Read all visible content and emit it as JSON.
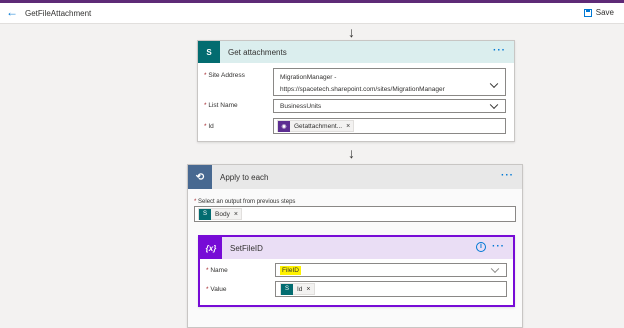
{
  "header": {
    "back_icon": "back-arrow-icon",
    "title": "GetFileAttachment",
    "save_label": "Save"
  },
  "get_attachments": {
    "title": "Get attachments",
    "header_color": "#dbeeee",
    "icon_color": "#036c70",
    "fields": {
      "site_address": {
        "label": "Site Address",
        "line1": "MigrationManager -",
        "line2": "https://spacetech.sharepoint.com/sites/MigrationManager"
      },
      "list_name": {
        "label": "List Name",
        "value": "BusinessUnits"
      },
      "id": {
        "label": "Id",
        "token": "Getattachment..."
      }
    }
  },
  "apply_to_each": {
    "title": "Apply to each",
    "select_label": "Select an output from previous steps",
    "token": "Body"
  },
  "set_file_id": {
    "title": "SetFileID",
    "icon_text": "{x}",
    "icon_color": "#770bd6",
    "header_color": "#eadef5",
    "fields": {
      "name": {
        "label": "Name",
        "value": "FileID",
        "highlight_color": "#fff200"
      },
      "value": {
        "label": "Value",
        "token": "Id"
      }
    }
  }
}
